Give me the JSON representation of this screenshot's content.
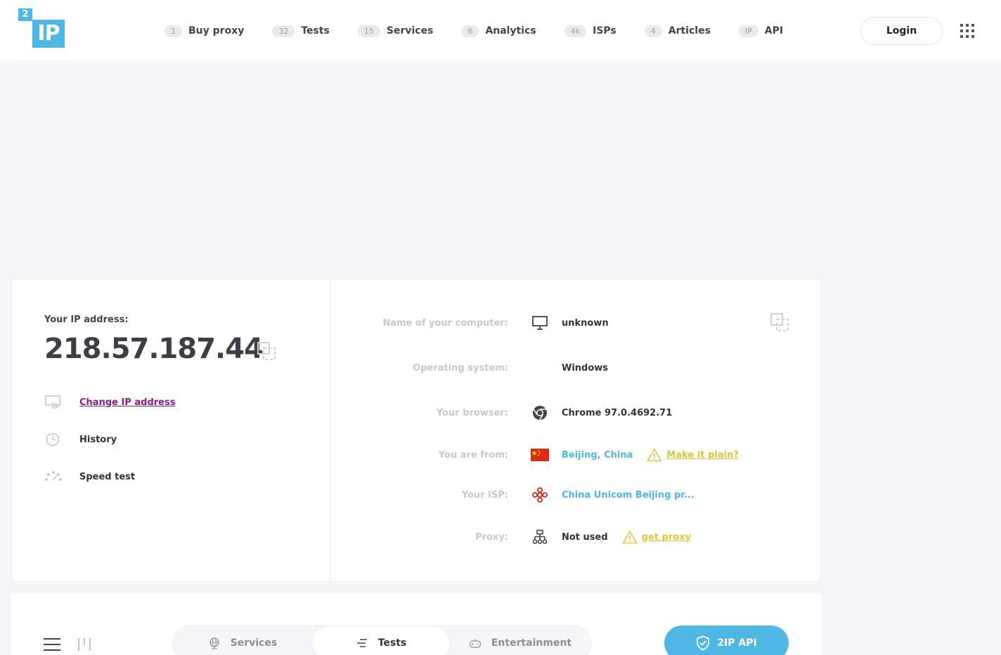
{
  "logo": {
    "small": "2",
    "big": "IP"
  },
  "nav": [
    {
      "badge": "1",
      "label": "Buy proxy"
    },
    {
      "badge": "32",
      "label": "Tests"
    },
    {
      "badge": "15",
      "label": "Services"
    },
    {
      "badge": "6",
      "label": "Analytics"
    },
    {
      "badge": "4k",
      "label": "ISPs"
    },
    {
      "badge": "4",
      "label": "Articles"
    },
    {
      "badge": "IP",
      "label": "API"
    }
  ],
  "header": {
    "login_label": "Login",
    "menu_icon": "apps-grid-icon"
  },
  "ip": {
    "label": "Your IP address:",
    "value": "218.57.187.44"
  },
  "actions": {
    "change_ip": "Change IP address",
    "history": "History",
    "speed_test": "Speed test"
  },
  "info": {
    "computer_key": "Name of your computer:",
    "computer_val": "unknown",
    "os_key": "Operating system:",
    "os_val": "Windows",
    "browser_key": "Your browser:",
    "browser_val": "Chrome 97.0.4692.71",
    "location_key": "You are from:",
    "location_val": "Beijing, China",
    "location_warn": "Make it plain?",
    "isp_key": "Your ISP:",
    "isp_val": "China Unicom Beijing pr...",
    "proxy_key": "Proxy:",
    "proxy_val": "Not used",
    "proxy_warn": "get proxy"
  },
  "bottom": {
    "tabs": [
      {
        "label": "Services"
      },
      {
        "label": "Tests"
      },
      {
        "label": "Entertainment"
      }
    ],
    "active_tab": "Tests",
    "api_label": "2IP API"
  },
  "colors": {
    "accent": "#4fb7e4",
    "link_purple": "#8b1a8f",
    "warning_yellow": "#e2c23a",
    "flag_red": "#de2910"
  }
}
